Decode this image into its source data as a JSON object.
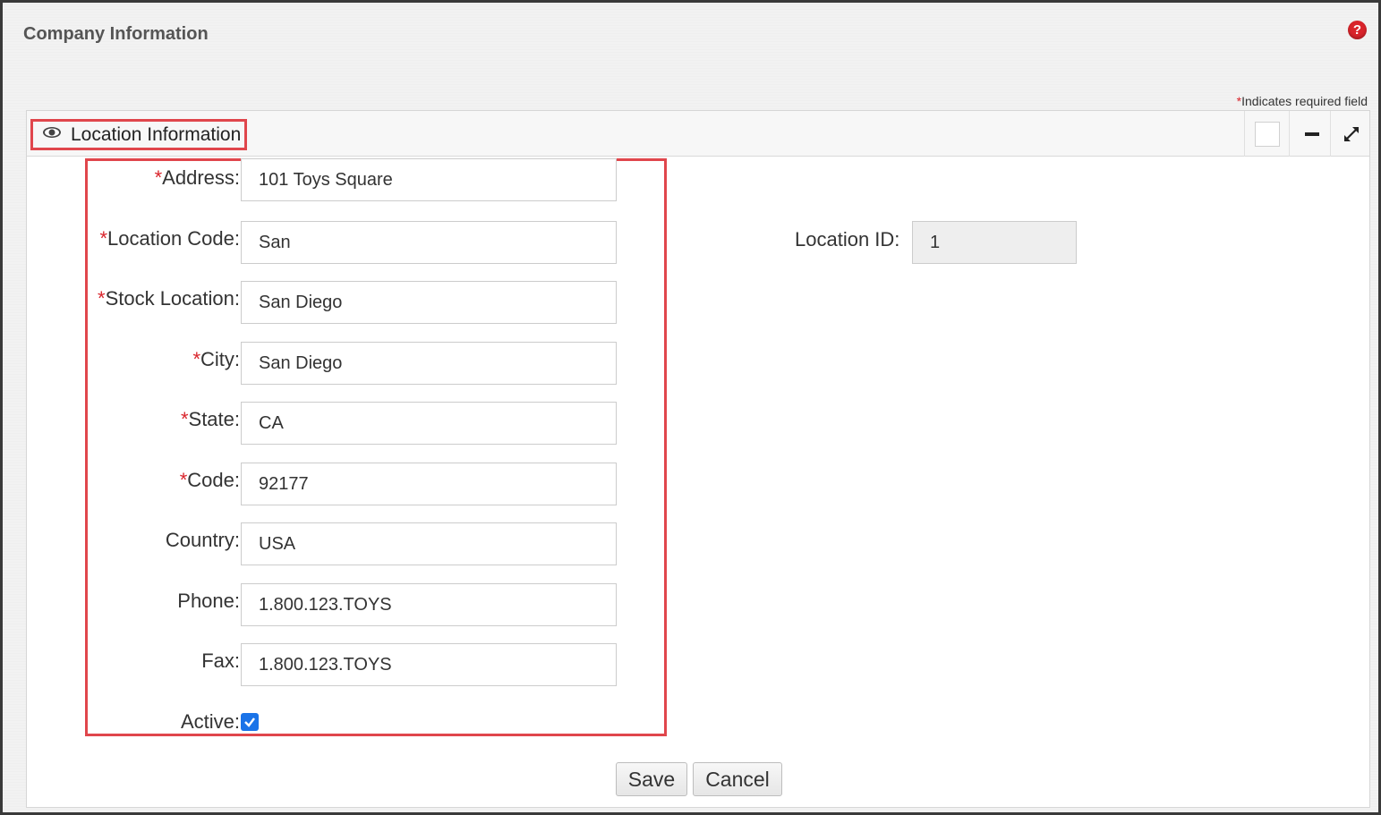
{
  "page": {
    "title": "Company Information",
    "help_icon": "question-circle-icon",
    "required_note_star": "*",
    "required_note_text": "Indicates required field"
  },
  "panel": {
    "title": "Location Information",
    "title_icon": "eye-icon",
    "header_buttons": [
      "square-toggle",
      "minimize-icon",
      "expand-icon"
    ]
  },
  "form": {
    "fields": [
      {
        "label": "Address:",
        "required": true,
        "value": "101 Toys Square"
      },
      {
        "label": "Location Code:",
        "required": true,
        "value": "San"
      },
      {
        "label": "Stock Location:",
        "required": true,
        "value": "San Diego"
      },
      {
        "label": "City:",
        "required": true,
        "value": "San Diego"
      },
      {
        "label": "State:",
        "required": true,
        "value": "CA"
      },
      {
        "label": "Code:",
        "required": true,
        "value": "92177"
      },
      {
        "label": "Country:",
        "required": false,
        "value": "USA"
      },
      {
        "label": "Phone:",
        "required": false,
        "value": "1.800.123.TOYS"
      },
      {
        "label": "Fax:",
        "required": false,
        "value": "1.800.123.TOYS"
      }
    ],
    "active_label": "Active:",
    "active_checked": true,
    "location_id_label": "Location ID:",
    "location_id_value": "1"
  },
  "buttons": {
    "save": "Save",
    "cancel": "Cancel"
  },
  "colors": {
    "required_star": "#d9242b",
    "highlight_border": "#e0464c",
    "checkbox": "#1a73e8"
  }
}
